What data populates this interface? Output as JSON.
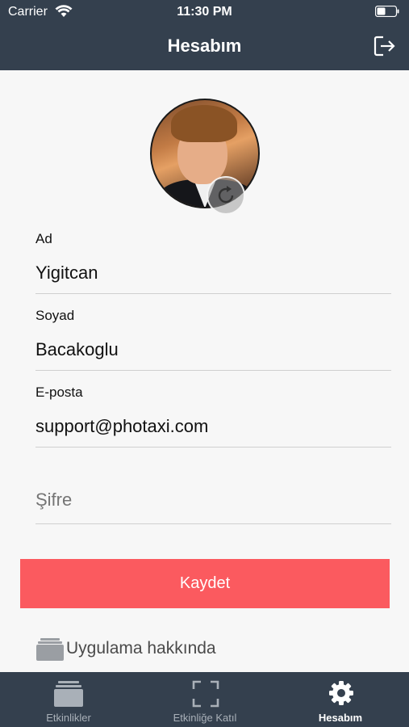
{
  "status_bar": {
    "carrier": "Carrier",
    "time": "11:30 PM"
  },
  "header": {
    "title": "Hesabım",
    "logout_icon": "logout-icon"
  },
  "profile": {
    "avatar": "avatar-photo",
    "rotate_icon": "rotate-icon"
  },
  "form": {
    "first_name": {
      "label": "Ad",
      "value": "Yigitcan"
    },
    "last_name": {
      "label": "Soyad",
      "value": "Bacakoglu"
    },
    "email": {
      "label": "E-posta",
      "value": "support@photaxi.com"
    },
    "password": {
      "placeholder": "Şifre"
    }
  },
  "save_button": {
    "label": "Kaydet",
    "color": "#fb5a5f"
  },
  "about": {
    "label": "Uygulama hakkında",
    "icon": "app-stack-icon"
  },
  "tabbar": {
    "items": [
      {
        "label": "Etkinlikler",
        "icon": "events-icon",
        "active": false
      },
      {
        "label": "Etkinliğe Katıl",
        "icon": "scan-frame-icon",
        "active": false
      },
      {
        "label": "Hesabım",
        "icon": "gear-icon",
        "active": true
      }
    ]
  },
  "colors": {
    "bar_background": "#34404e",
    "page_background": "#f7f7f7",
    "accent": "#fb5a5f"
  }
}
